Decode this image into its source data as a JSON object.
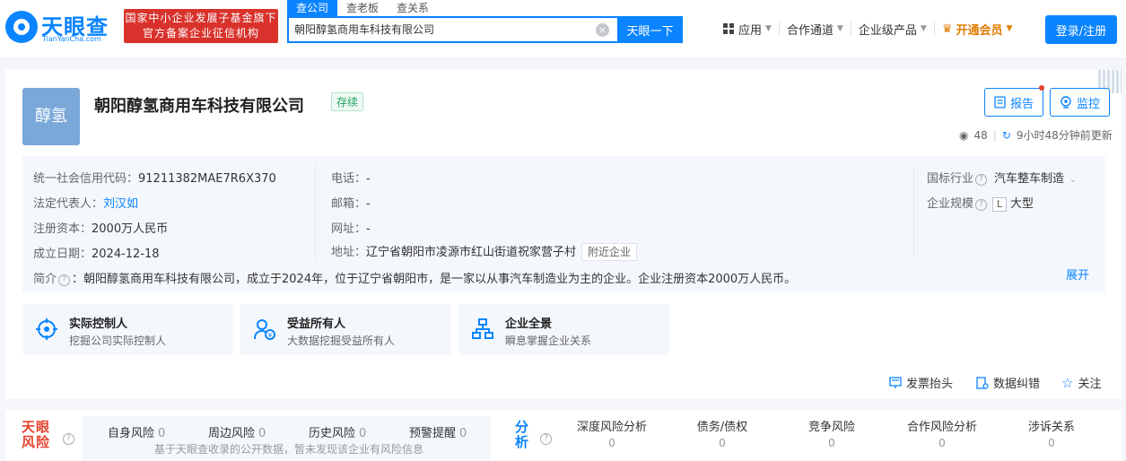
{
  "header": {
    "logo_cn": "天眼查",
    "logo_en": "TianYanCha.com",
    "gov_line1": "国家中小企业发展子基金旗下",
    "gov_line2": "官方备案企业征信机构",
    "search_tabs": [
      "查公司",
      "查老板",
      "查关系"
    ],
    "search_value": "朝阳醇氢商用车科技有限公司",
    "search_button": "天眼一下",
    "nav": [
      "应用",
      "合作通道",
      "企业级产品",
      "开通会员"
    ],
    "login_button": "登录/注册"
  },
  "company": {
    "avatar_text": "醇氢",
    "name": "朝阳醇氢商用车科技有限公司",
    "status": "存续",
    "report_label": "报告",
    "monitor_label": "监控",
    "views": "48",
    "updated": "9小时48分钟前更新"
  },
  "info": {
    "credit_code_label": "统一社会信用代码：",
    "credit_code": "91211382MAE7R6X370",
    "legal_rep_label": "法定代表人：",
    "legal_rep": "刘汉如",
    "capital_label": "注册资本：",
    "capital": "2000万人民币",
    "founded_label": "成立日期：",
    "founded": "2024-12-18",
    "phone_label": "电话：",
    "phone": "-",
    "email_label": "邮箱：",
    "email": "-",
    "website_label": "网址：",
    "website": "-",
    "address_label": "地址：",
    "address": "辽宁省朝阳市凌源市红山街道祝家营子村",
    "nearby": "附近企业",
    "industry_label": "国标行业",
    "industry": "汽车整车制造",
    "scale_label": "企业规模",
    "scale_badge": "L",
    "scale": "大型",
    "intro_label": "简介",
    "intro": "：朝阳醇氢商用车科技有限公司，成立于2024年，位于辽宁省朝阳市，是一家以从事汽车制造业为主的企业。企业注册资本2000万人民币。",
    "expand": "展开"
  },
  "features": [
    {
      "title": "实际控制人",
      "sub": "挖掘公司实际控制人"
    },
    {
      "title": "受益所有人",
      "sub": "大数据挖掘受益所有人"
    },
    {
      "title": "企业全景",
      "sub": "瞬息掌握企业关系"
    }
  ],
  "actions": [
    "发票抬头",
    "数据纠错",
    "关注"
  ],
  "risk": {
    "logo_line1": "天眼",
    "logo_line2": "风险",
    "items": [
      {
        "label": "自身风险",
        "count": "0"
      },
      {
        "label": "周边风险",
        "count": "0"
      },
      {
        "label": "历史风险",
        "count": "0"
      },
      {
        "label": "预警提醒",
        "count": "0"
      }
    ],
    "note": "基于天眼查收录的公开数据，暂未发现该企业有风险信息"
  },
  "analysis": {
    "logo_line1": "分",
    "logo_line2": "析",
    "items": [
      {
        "label": "深度风险分析",
        "value": "0"
      },
      {
        "label": "债务/债权",
        "value": "0"
      },
      {
        "label": "竞争风险",
        "value": "0"
      },
      {
        "label": "合作风险分析",
        "value": "0"
      },
      {
        "label": "涉诉关系",
        "value": "0"
      }
    ]
  }
}
